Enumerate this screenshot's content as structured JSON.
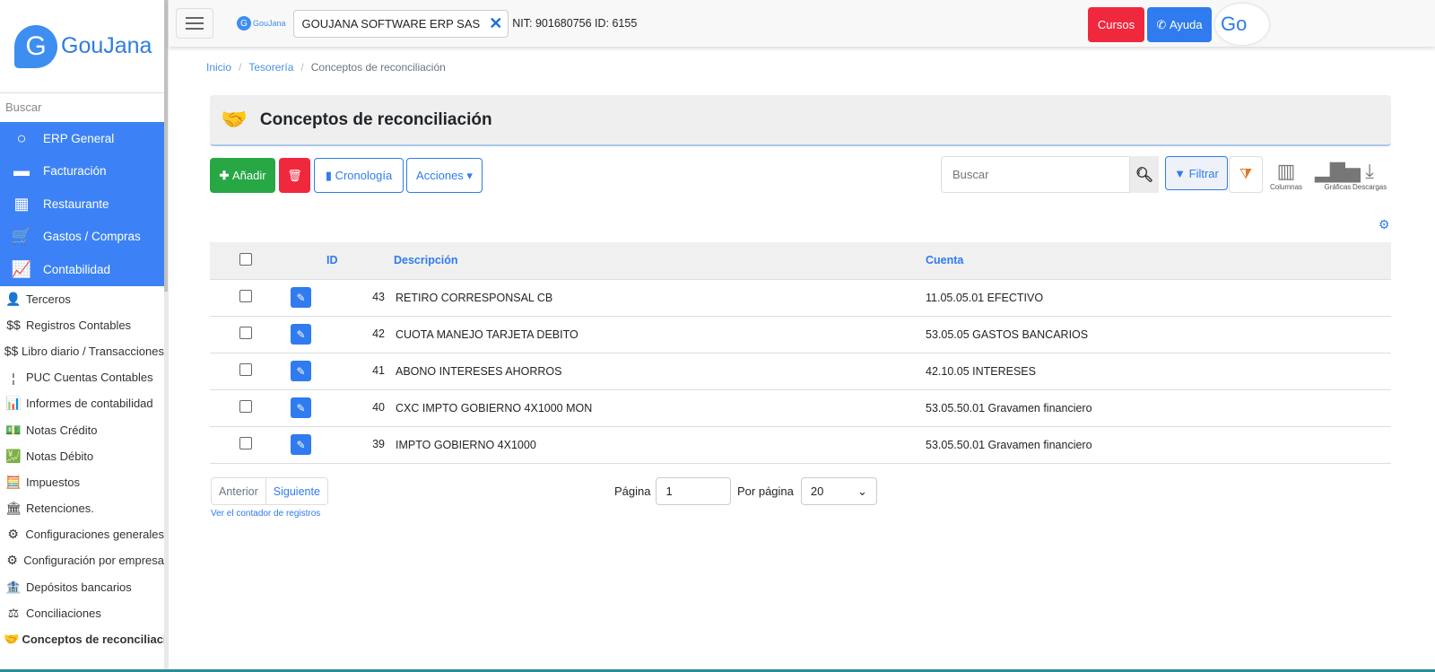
{
  "sidebar": {
    "logo": "GouJana",
    "logo_letter": "G",
    "search_placeholder": "Buscar",
    "main_items": [
      {
        "label": "ERP General",
        "icon": "○"
      },
      {
        "label": "Facturación",
        "icon": "▬"
      },
      {
        "label": "Restaurante",
        "icon": "▦"
      },
      {
        "label": "Gastos / Compras",
        "icon": "🛒"
      },
      {
        "label": "Contabilidad",
        "icon": "📈"
      }
    ],
    "sub_items": [
      {
        "label": "Terceros",
        "icon": "👤"
      },
      {
        "label": "Registros Contables",
        "icon": "$$"
      },
      {
        "label": "Libro diario / Transacciones",
        "icon": "$$"
      },
      {
        "label": "PUC Cuentas Contables",
        "icon": "¦"
      },
      {
        "label": "Informes de contabilidad",
        "icon": "📊"
      },
      {
        "label": "Notas Crédito",
        "icon": "💵"
      },
      {
        "label": "Notas Débito",
        "icon": "💹"
      },
      {
        "label": "Impuestos",
        "icon": "🧮"
      },
      {
        "label": "Retenciones.",
        "icon": "🏛"
      },
      {
        "label": "Configuraciones generales",
        "icon": "⚙"
      },
      {
        "label": "Configuración por empresa",
        "icon": "⚙"
      },
      {
        "label": "Depósitos bancarios",
        "icon": "🏦"
      },
      {
        "label": "Conciliaciones",
        "icon": "⚖"
      },
      {
        "label": "Conceptos de reconciliación",
        "icon": "🤝"
      }
    ]
  },
  "topbar": {
    "mini_logo": "GouJana",
    "company": "GOUJANA SOFTWARE ERP SAS",
    "nit": "NIT: 901680756 ID: 6155",
    "cursos": "Cursos",
    "ayuda": "Ayuda",
    "avatar": "Go"
  },
  "breadcrumb": {
    "home": "Inicio",
    "section": "Tesorería",
    "current": "Conceptos de reconciliación"
  },
  "page": {
    "title": "Conceptos de reconciliación"
  },
  "toolbar": {
    "add": "Añadir",
    "timeline": "Cronología",
    "actions": "Acciones",
    "search_placeholder": "Buscar",
    "filter": "Filtrar",
    "columns": "Columnas",
    "charts": "Gráficas",
    "downloads": "Descargas"
  },
  "table": {
    "headers": {
      "id": "ID",
      "description": "Descripción",
      "account": "Cuenta"
    },
    "rows": [
      {
        "id": "43",
        "description": "RETIRO CORRESPONSAL CB",
        "account": "11.05.05.01 EFECTIVO"
      },
      {
        "id": "42",
        "description": "CUOTA MANEJO TARJETA DEBITO",
        "account": "53.05.05 GASTOS BANCARIOS"
      },
      {
        "id": "41",
        "description": "ABONO INTERESES AHORROS",
        "account": "42.10.05 INTERESES"
      },
      {
        "id": "40",
        "description": "CXC IMPTO GOBIERNO 4X1000 MON",
        "account": "53.05.50.01 Gravamen financiero"
      },
      {
        "id": "39",
        "description": "IMPTO GOBIERNO 4X1000",
        "account": "53.05.50.01 Gravamen financiero"
      }
    ]
  },
  "pagination": {
    "prev": "Anterior",
    "next": "Siguiente",
    "count_link": "Ver el contador de registros",
    "page_label": "Página",
    "page_value": "1",
    "per_page_label": "Por página",
    "per_page_value": "20"
  }
}
